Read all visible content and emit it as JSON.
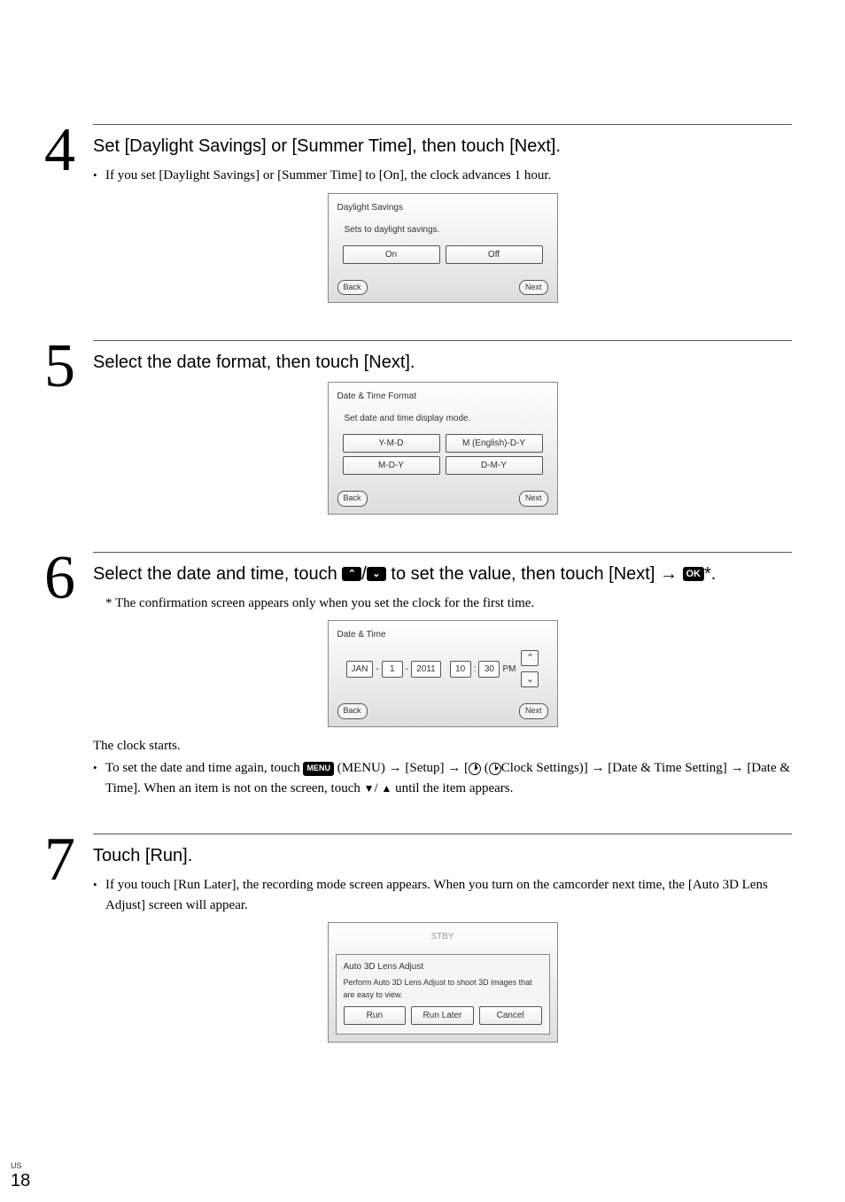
{
  "step4": {
    "num": "4",
    "heading": "Set [Daylight Savings] or [Summer Time], then touch [Next].",
    "bullet": "If you set [Daylight Savings] or [Summer Time] to [On], the clock advances 1 hour.",
    "screen": {
      "title": "Daylight Savings",
      "text": "Sets to daylight savings.",
      "btn_on": "On",
      "btn_off": "Off",
      "back": "Back",
      "next": "Next"
    }
  },
  "step5": {
    "num": "5",
    "heading": "Select the date format, then touch [Next].",
    "screen": {
      "title": "Date & Time Format",
      "text": "Set date and time display mode.",
      "btn_a": "Y-M-D",
      "btn_b": "M (English)-D-Y",
      "btn_c": "M-D-Y",
      "btn_d": "D-M-Y",
      "back": "Back",
      "next": "Next"
    }
  },
  "step6": {
    "num": "6",
    "heading_a": "Select the date and time, touch ",
    "heading_b": " to set the value, then touch [Next] ",
    "heading_c": "*.",
    "ok": "OK",
    "slash": "/",
    "up_glyph": "⌃",
    "down_glyph": "⌄",
    "arrow": "→",
    "asterisk": "* The confirmation screen appears only when you set the clock for the first time.",
    "screen": {
      "title": "Date & Time",
      "month": "JAN",
      "day": "1",
      "year": "2011",
      "hour": "10",
      "minute": "30",
      "ampm": "PM",
      "sep1": "-",
      "sep2": "-",
      "sep3": ":",
      "up": "⌃",
      "down": "⌄",
      "back": "Back",
      "next": "Next"
    },
    "after_text": "The clock starts.",
    "bullet_a": "To set the date and time again, touch ",
    "menu_label": "MENU",
    "bullet_b": " (MENU) ",
    "bullet_c": " [Setup] ",
    "bullet_d": " [",
    "bullet_e": " (",
    "bullet_f": "Clock Settings)] ",
    "bullet_g": " [Date & Time Setting] ",
    "bullet_h": " [Date & Time]. When an item is not on the screen, touch ",
    "bullet_i": " until the item appears.",
    "tri_down": "▼",
    "tri_up": "▲"
  },
  "step7": {
    "num": "7",
    "heading": "Touch [Run].",
    "bullet": "If you touch [Run Later], the recording mode screen appears. When you turn on the camcorder next time, the [Auto 3D Lens Adjust] screen will appear.",
    "screen": {
      "stby": "STBY",
      "title": "Auto 3D Lens Adjust",
      "text": "Perform Auto 3D Lens Adjust to shoot 3D images that are easy to view.",
      "run": "Run",
      "later": "Run Later",
      "cancel": "Cancel"
    }
  },
  "footer": {
    "us": "US",
    "page": "18"
  }
}
